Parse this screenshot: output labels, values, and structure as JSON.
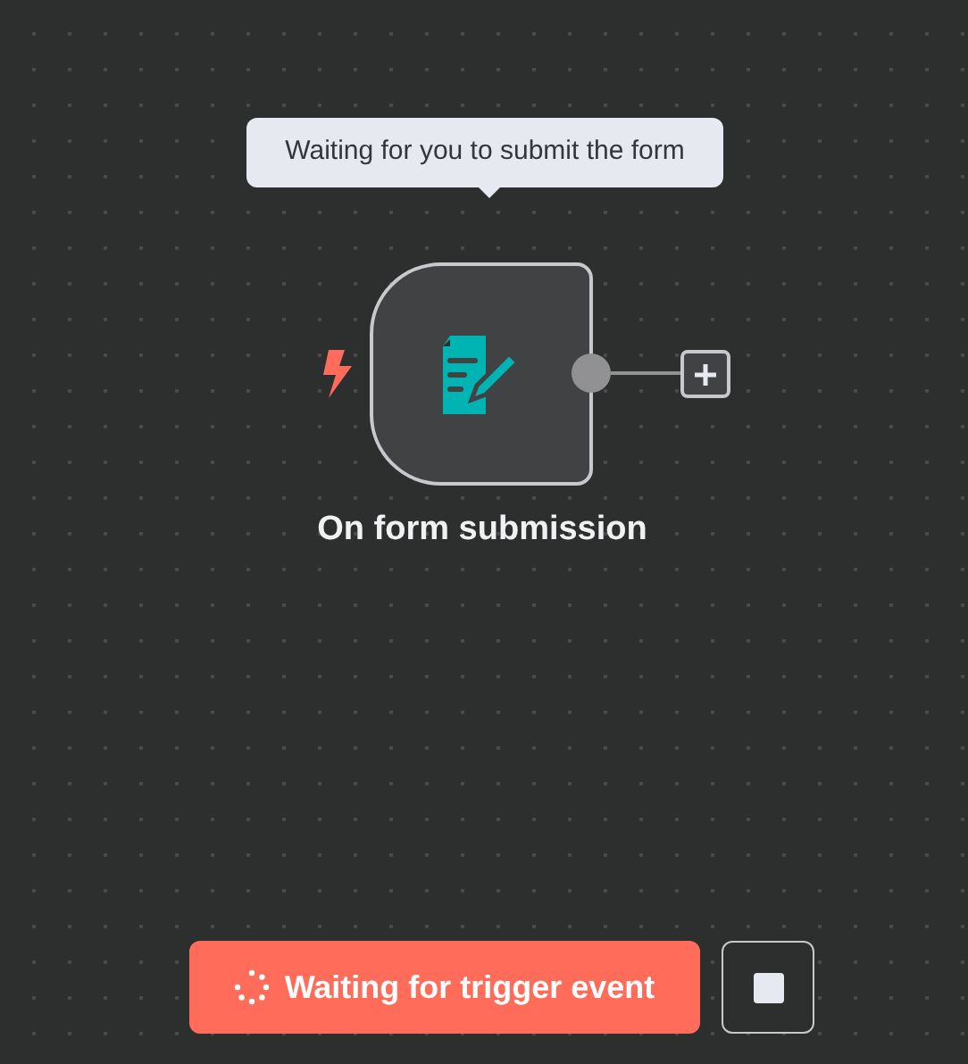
{
  "tooltip": {
    "text": "Waiting for you to submit the form"
  },
  "node": {
    "label": "On form submission",
    "trigger": true
  },
  "footer": {
    "run_button": {
      "label": "Waiting for trigger event"
    }
  }
}
